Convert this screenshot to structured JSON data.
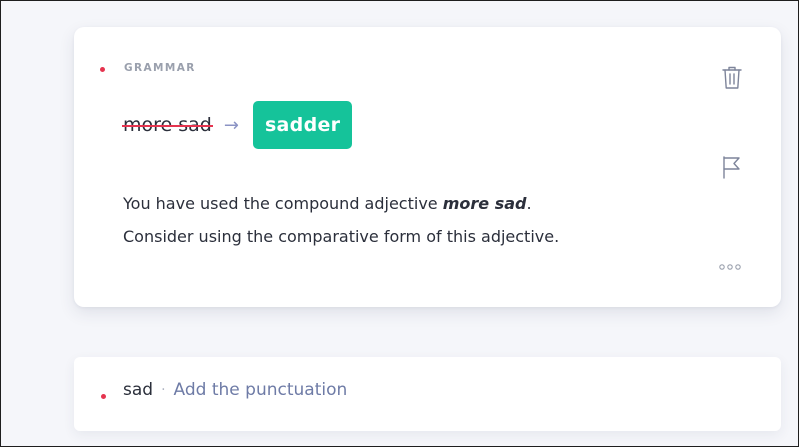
{
  "suggestion": {
    "category": "GRAMMAR",
    "original": "more sad",
    "arrow": "→",
    "replacement": "sadder",
    "explanation": {
      "before": "You have used the compound adjective ",
      "emphasis": "more sad",
      "after": ".",
      "line2": "Consider using the comparative form of this adjective."
    },
    "actions": {
      "delete_icon": "trash-icon",
      "flag_icon": "flag-icon",
      "more_icon": "more-options-icon"
    },
    "accent_color": "#15c39a",
    "error_color": "#e5344f"
  },
  "collapsed": {
    "word": "sad",
    "separator": "·",
    "hint": "Add the punctuation"
  }
}
